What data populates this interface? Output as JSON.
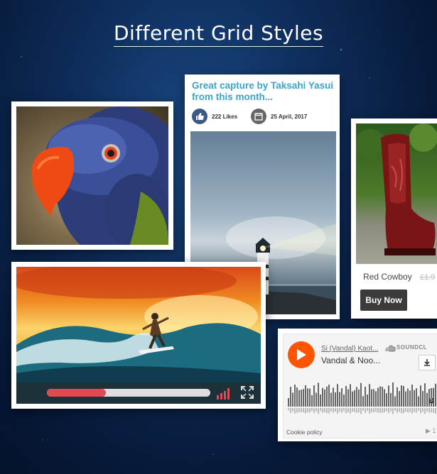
{
  "page": {
    "heading": "Different Grid Styles",
    "colors": {
      "accent_blue": "#3aa5c9",
      "soundcloud_orange": "#ff5500",
      "progress_red": "#e04a50"
    }
  },
  "cards": {
    "parrot": {
      "icon": "parrot-photo"
    },
    "lighthouse": {
      "title": "Great capture by Taksahi Yasui from this month...",
      "likes": "222 Likes",
      "date": "25 April, 2017",
      "like_icon": "thumbs-up-icon",
      "date_icon": "calendar-icon"
    },
    "boot": {
      "name": "Red Cowboy",
      "price": "£1,9",
      "buy_label": "Buy Now"
    },
    "video": {
      "progress": 0.36,
      "volume_icon": "volume-bars-icon",
      "fullscreen_icon": "fullscreen-icon"
    },
    "soundcloud": {
      "artist": "Si (Vandal) Kaot...",
      "track": "Vandal & Noo...",
      "brand": "SOUNDCL",
      "cookie": "Cookie policy",
      "plays": "1",
      "time": "5"
    }
  }
}
